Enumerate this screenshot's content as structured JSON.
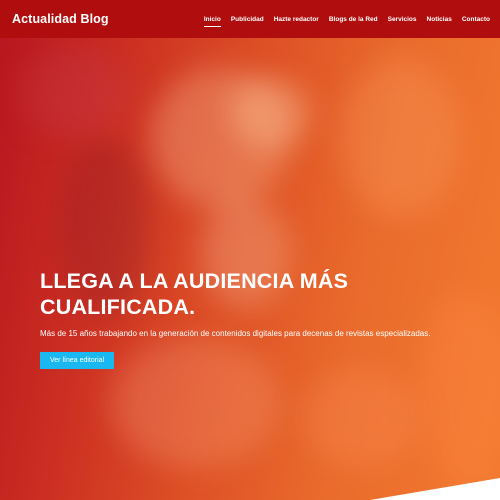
{
  "header": {
    "logo": "Actualidad Blog",
    "nav": [
      {
        "label": "Inicio",
        "active": true
      },
      {
        "label": "Publicidad",
        "active": false
      },
      {
        "label": "Hazte redactor",
        "active": false
      },
      {
        "label": "Blogs de la Red",
        "active": false
      },
      {
        "label": "Servicios",
        "active": false
      },
      {
        "label": "Noticias",
        "active": false
      },
      {
        "label": "Contacto",
        "active": false
      }
    ]
  },
  "hero": {
    "title": "LLEGA A LA AUDIENCIA MÁS CUALIFICADA.",
    "subtitle": "Más de 15 años trabajando en la generación de contenidos digitales para decenas de revistas especializadas.",
    "cta_label": "Ver línea editorial"
  },
  "colors": {
    "header_bg": "#b00e0e",
    "accent_button": "#1ab8f0",
    "gradient_start": "#b8171f",
    "gradient_end": "#f27a2f"
  }
}
